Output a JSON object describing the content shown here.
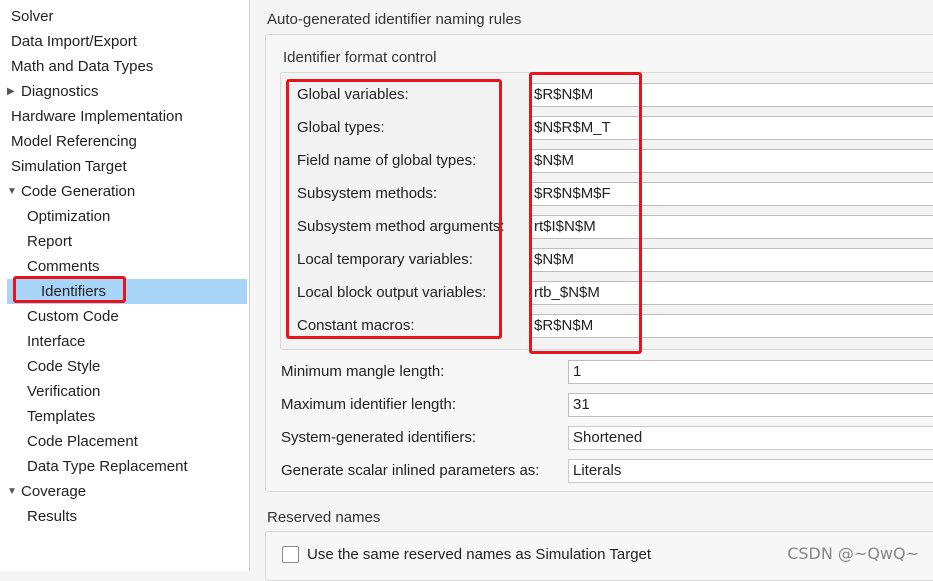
{
  "tree": {
    "items": [
      {
        "label": "Solver",
        "twisty": ""
      },
      {
        "label": "Data Import/Export",
        "twisty": ""
      },
      {
        "label": "Math and Data Types",
        "twisty": ""
      },
      {
        "label": "Diagnostics",
        "twisty": "▶"
      },
      {
        "label": "Hardware Implementation",
        "twisty": ""
      },
      {
        "label": "Model Referencing",
        "twisty": ""
      },
      {
        "label": "Simulation Target",
        "twisty": ""
      },
      {
        "label": "Code Generation",
        "twisty": "▼"
      },
      {
        "label": "Optimization",
        "twisty": ""
      },
      {
        "label": "Report",
        "twisty": ""
      },
      {
        "label": "Comments",
        "twisty": ""
      },
      {
        "label": "Identifiers",
        "twisty": ""
      },
      {
        "label": "Custom Code",
        "twisty": ""
      },
      {
        "label": "Interface",
        "twisty": ""
      },
      {
        "label": "Code Style",
        "twisty": ""
      },
      {
        "label": "Verification",
        "twisty": ""
      },
      {
        "label": "Templates",
        "twisty": ""
      },
      {
        "label": "Code Placement",
        "twisty": ""
      },
      {
        "label": "Data Type Replacement",
        "twisty": ""
      },
      {
        "label": "Coverage",
        "twisty": "▼"
      },
      {
        "label": "Results",
        "twisty": ""
      }
    ],
    "selected": "Identifiers"
  },
  "main": {
    "section_title": "Auto-generated identifier naming rules",
    "format_group_title": "Identifier format control",
    "format_rows": [
      {
        "label": "Global variables:",
        "value": "$R$N$M"
      },
      {
        "label": "Global types:",
        "value": "$N$R$M_T"
      },
      {
        "label": "Field name of global types:",
        "value": "$N$M"
      },
      {
        "label": "Subsystem methods:",
        "value": "$R$N$M$F"
      },
      {
        "label": "Subsystem method arguments:",
        "value": "rt$I$N$M"
      },
      {
        "label": "Local temporary variables:",
        "value": "$N$M"
      },
      {
        "label": "Local block output variables:",
        "value": "rtb_$N$M"
      },
      {
        "label": "Constant macros:",
        "value": "$R$N$M"
      }
    ],
    "other_rows": [
      {
        "label": "Minimum mangle length:",
        "value": "1"
      },
      {
        "label": "Maximum identifier length:",
        "value": "31"
      },
      {
        "label": "System-generated identifiers:",
        "value": "Shortened"
      },
      {
        "label": "Generate scalar inlined parameters as:",
        "value": "Literals"
      }
    ],
    "reserved_title": "Reserved names",
    "reserved_checkbox_label": "Use the same reserved names as Simulation Target"
  },
  "watermark": "CSDN @~QwQ~",
  "colors": {
    "selected": "#a8d4f7",
    "annotation": "#e8141b"
  }
}
